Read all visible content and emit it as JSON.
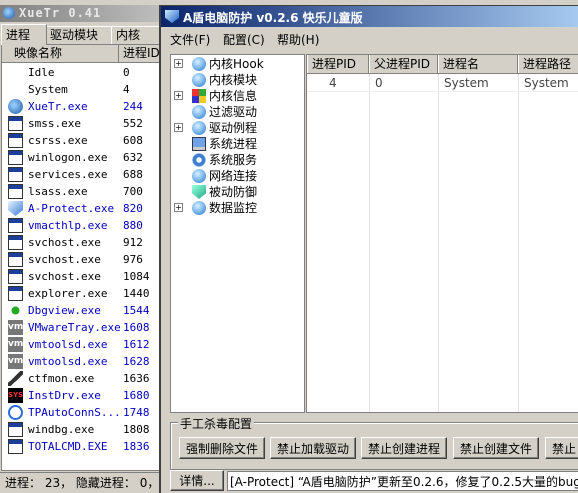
{
  "xuetr": {
    "title": "XueTr 0.41",
    "tabs": [
      "进程",
      "驱动模块",
      "内核"
    ],
    "columns": [
      "映像名称",
      "进程ID"
    ],
    "processes": [
      {
        "name": "Idle",
        "pid": "0",
        "icon": "none",
        "blue": false
      },
      {
        "name": "System",
        "pid": "4",
        "icon": "none",
        "blue": false
      },
      {
        "name": "XueTr.exe",
        "pid": "244",
        "icon": "xuetr-icon",
        "blue": true
      },
      {
        "name": "smss.exe",
        "pid": "552",
        "icon": "window-icon",
        "blue": false
      },
      {
        "name": "csrss.exe",
        "pid": "608",
        "icon": "window-icon",
        "blue": false
      },
      {
        "name": "winlogon.exe",
        "pid": "632",
        "icon": "winlogon-icon",
        "blue": false
      },
      {
        "name": "services.exe",
        "pid": "688",
        "icon": "window-icon",
        "blue": false
      },
      {
        "name": "lsass.exe",
        "pid": "700",
        "icon": "window-icon",
        "blue": false
      },
      {
        "name": "A-Protect.exe",
        "pid": "820",
        "icon": "shield-icon",
        "blue": true
      },
      {
        "name": "vmacthlp.exe",
        "pid": "880",
        "icon": "window-icon",
        "blue": true
      },
      {
        "name": "svchost.exe",
        "pid": "912",
        "icon": "window-icon",
        "blue": false
      },
      {
        "name": "svchost.exe",
        "pid": "976",
        "icon": "window-icon",
        "blue": false
      },
      {
        "name": "svchost.exe",
        "pid": "1084",
        "icon": "window-icon",
        "blue": false
      },
      {
        "name": "explorer.exe",
        "pid": "1440",
        "icon": "explorer-icon",
        "blue": false
      },
      {
        "name": "Dbgview.exe",
        "pid": "1544",
        "icon": "bug-icon",
        "blue": true
      },
      {
        "name": "VMwareTray.exe",
        "pid": "1608",
        "icon": "vmware-icon",
        "blue": true
      },
      {
        "name": "vmtoolsd.exe",
        "pid": "1612",
        "icon": "vmware-icon",
        "blue": true
      },
      {
        "name": "vmtoolsd.exe",
        "pid": "1628",
        "icon": "vmware-icon",
        "blue": true
      },
      {
        "name": "ctfmon.exe",
        "pid": "1636",
        "icon": "pen-icon",
        "blue": false
      },
      {
        "name": "InstDrv.exe",
        "pid": "1680",
        "icon": "sys-icon",
        "blue": true
      },
      {
        "name": "TPAutoConnS...",
        "pid": "1748",
        "icon": "ie-icon",
        "blue": true
      },
      {
        "name": "windbg.exe",
        "pid": "1808",
        "icon": "windbg-icon",
        "blue": false
      },
      {
        "name": "TOTALCMD.EXE",
        "pid": "1836",
        "icon": "totalcmd-icon",
        "blue": true
      }
    ],
    "status": "进程： 23， 隐藏进程： 0，"
  },
  "aprotect": {
    "title": "A盾电脑防护 v0.2.6 快乐儿童版",
    "menu": [
      "文件(F)",
      "配置(C)",
      "帮助(H)"
    ],
    "tree": [
      {
        "label": "内核Hook",
        "expandable": true,
        "icon": "globe-icon"
      },
      {
        "label": "内核模块",
        "expandable": false,
        "icon": "globe-icon"
      },
      {
        "label": "内核信息",
        "expandable": true,
        "icon": "windows-icon"
      },
      {
        "label": "过滤驱动",
        "expandable": false,
        "icon": "globe-icon"
      },
      {
        "label": "驱动例程",
        "expandable": true,
        "icon": "globe-icon"
      },
      {
        "label": "系统进程",
        "expandable": false,
        "icon": "computer-icon"
      },
      {
        "label": "系统服务",
        "expandable": false,
        "icon": "gear-icon"
      },
      {
        "label": "网络连接",
        "expandable": false,
        "icon": "globe-icon"
      },
      {
        "label": "被动防御",
        "expandable": false,
        "icon": "shield-icon"
      },
      {
        "label": "数据监控",
        "expandable": true,
        "icon": "globe-icon"
      }
    ],
    "table": {
      "columns": [
        "进程PID",
        "父进程PID",
        "进程名",
        "进程路径"
      ],
      "rows": [
        [
          "4",
          "0",
          "System",
          "System"
        ]
      ]
    },
    "group_title": "手工杀毒配置",
    "buttons": [
      "强制删除文件",
      "禁止加载驱动",
      "禁止创建进程",
      "禁止创建文件",
      "禁止"
    ],
    "detail_button": "详情...",
    "log": "[A-Protect] “A盾电脑防护”更新至0.2.6，修复了0.2.5大量的bug~"
  }
}
